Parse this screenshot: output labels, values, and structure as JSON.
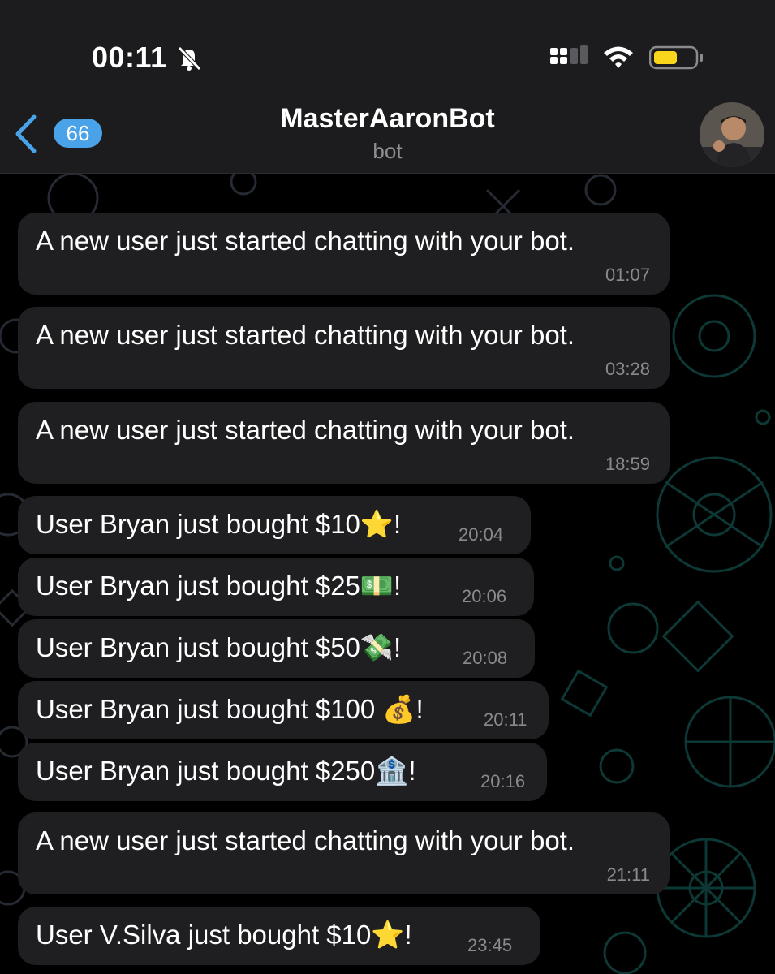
{
  "status_bar": {
    "time": "00:11",
    "icons": [
      "bell-slash-icon",
      "cellular-signal-icon",
      "wifi-icon",
      "battery-icon"
    ],
    "battery_color": "#f9d51b"
  },
  "header": {
    "back_count": "66",
    "title": "MasterAaronBot",
    "subtitle": "bot",
    "accent_color": "#4aa3e8"
  },
  "messages": [
    {
      "text": "A new user just started chatting with your bot.",
      "time": "01:07"
    },
    {
      "text": "A new user just started chatting with your bot.",
      "time": "03:28"
    },
    {
      "text": "A new user just started chatting with your bot.",
      "time": "18:59"
    },
    {
      "text": "User Bryan just bought $10⭐️!",
      "time": "20:04"
    },
    {
      "text": "User Bryan just bought $25💵!",
      "time": "20:06"
    },
    {
      "text": "User Bryan just bought $50💸!",
      "time": "20:08"
    },
    {
      "text": "User Bryan just bought $100 💰!",
      "time": "20:11"
    },
    {
      "text": "User Bryan just bought $250🏦!",
      "time": "20:16"
    },
    {
      "text": "A new user just started chatting with your bot.",
      "time": "21:11"
    },
    {
      "text": "User V.Silva just bought $10⭐️!",
      "time": "23:45"
    }
  ]
}
